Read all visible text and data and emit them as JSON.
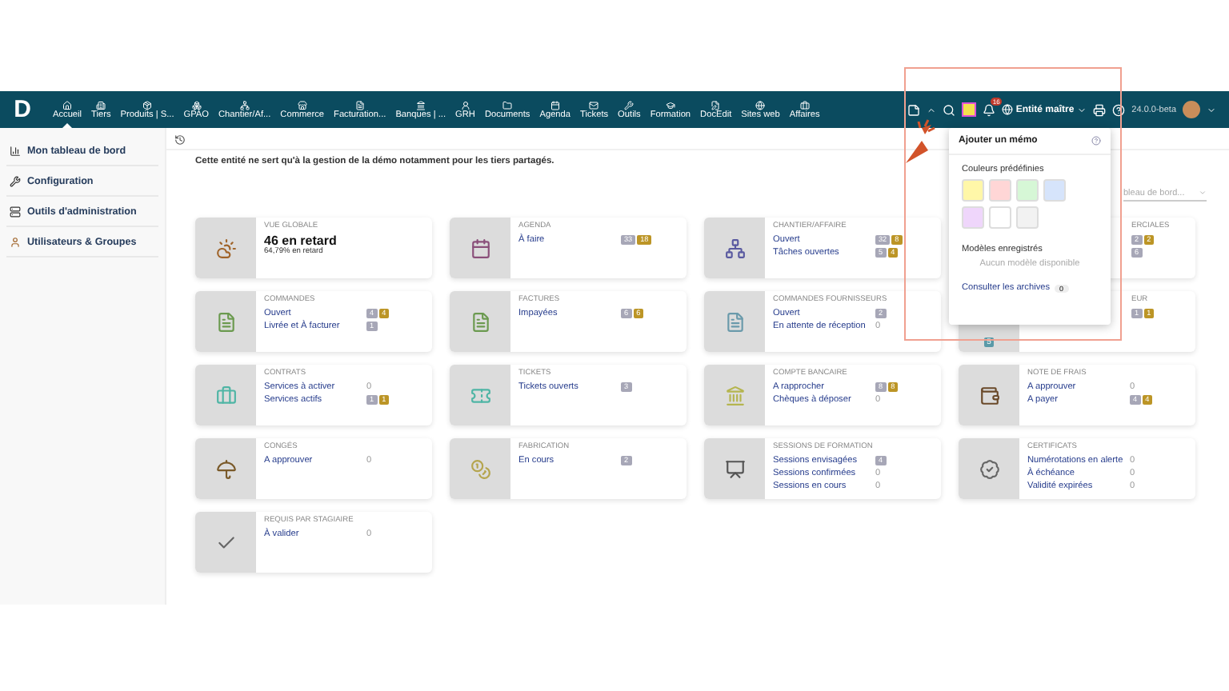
{
  "topbar": {
    "logo": "D",
    "menu": [
      {
        "label": "Accueil",
        "selected": true
      },
      {
        "label": "Tiers",
        "selected": false
      },
      {
        "label": "Produits | S...",
        "selected": false
      },
      {
        "label": "GPAO",
        "selected": false
      },
      {
        "label": "Chantier/Af...",
        "selected": false
      },
      {
        "label": "Commerce",
        "selected": false
      },
      {
        "label": "Facturation...",
        "selected": false
      },
      {
        "label": "Banques | ...",
        "selected": false
      },
      {
        "label": "GRH",
        "selected": false
      },
      {
        "label": "Documents",
        "selected": false
      },
      {
        "label": "Agenda",
        "selected": false
      },
      {
        "label": "Tickets",
        "selected": false
      },
      {
        "label": "Outils",
        "selected": false
      },
      {
        "label": "Formation",
        "selected": false
      },
      {
        "label": "DocEdit",
        "selected": false
      },
      {
        "label": "Sites web",
        "selected": false
      },
      {
        "label": "Affaires",
        "selected": false
      }
    ],
    "notification_count": "16",
    "entity": "Entité maître",
    "version": "24.0.0-beta"
  },
  "sidebar": {
    "items": [
      {
        "label": "Mon tableau de bord"
      },
      {
        "label": "Configuration"
      },
      {
        "label": "Outils d'administration"
      },
      {
        "label": "Utilisateurs & Groupes"
      }
    ]
  },
  "notice": "Cette entité ne sert qu'à la gestion de la démo notamment pour les tiers partagés.",
  "dashboard_select": "bleau de bord...",
  "cards": [
    {
      "kind": "summary",
      "title": "VUE GLOBALE",
      "headline": "46 en retard",
      "subline": "64,79% en retard"
    },
    {
      "kind": "list",
      "title": "AGENDA",
      "lines": [
        {
          "label": "À faire",
          "badges": [
            {
              "text": "33",
              "kind": "count"
            },
            {
              "text": "18",
              "kind": "late"
            }
          ]
        }
      ]
    },
    {
      "kind": "list",
      "title": "CHANTIER/AFFAIRE",
      "lines": [
        {
          "label": "Ouvert",
          "badges": [
            {
              "text": "32",
              "kind": "count"
            },
            {
              "text": "8",
              "kind": "late"
            }
          ]
        },
        {
          "label": "Tâches ouvertes",
          "badges": [
            {
              "text": "5",
              "kind": "count"
            },
            {
              "text": "4",
              "kind": "late"
            }
          ]
        }
      ]
    },
    {
      "kind": "list",
      "title": "ERCIALES",
      "covered": true,
      "lines": [
        {
          "badges": [
            {
              "text": "2",
              "kind": "count"
            },
            {
              "text": "2",
              "kind": "late"
            }
          ]
        },
        {
          "badges": [
            {
              "text": "6",
              "kind": "count"
            }
          ]
        }
      ]
    },
    {
      "kind": "list",
      "title": "COMMANDES",
      "lines": [
        {
          "label": "Ouvert",
          "badges": [
            {
              "text": "4",
              "kind": "count"
            },
            {
              "text": "4",
              "kind": "late"
            }
          ]
        },
        {
          "label": "Livrée et À facturer",
          "badges": [
            {
              "text": "1",
              "kind": "count"
            }
          ]
        }
      ]
    },
    {
      "kind": "list",
      "title": "FACTURES",
      "lines": [
        {
          "label": "Impayées",
          "badges": [
            {
              "text": "6",
              "kind": "count"
            },
            {
              "text": "6",
              "kind": "late"
            }
          ]
        }
      ]
    },
    {
      "kind": "list",
      "title": "COMMANDES FOURNISSEURS",
      "lines": [
        {
          "label": "Ouvert",
          "badges": [
            {
              "text": "2",
              "kind": "count"
            }
          ]
        },
        {
          "label": "En attente de réception",
          "value": "0"
        }
      ]
    },
    {
      "kind": "list",
      "title": "EUR",
      "covered": true,
      "icon_badge": "5",
      "lines": [
        {
          "badges": [
            {
              "text": "1",
              "kind": "count"
            },
            {
              "text": "1",
              "kind": "late"
            }
          ]
        }
      ]
    },
    {
      "kind": "list",
      "title": "CONTRATS",
      "lines": [
        {
          "label": "Services à activer",
          "value": "0"
        },
        {
          "label": "Services actifs",
          "badges": [
            {
              "text": "1",
              "kind": "count"
            },
            {
              "text": "1",
              "kind": "late"
            }
          ]
        }
      ]
    },
    {
      "kind": "list",
      "title": "TICKETS",
      "lines": [
        {
          "label": "Tickets ouverts",
          "badges": [
            {
              "text": "3",
              "kind": "count"
            }
          ]
        }
      ]
    },
    {
      "kind": "list",
      "title": "COMPTE BANCAIRE",
      "lines": [
        {
          "label": "A rapprocher",
          "badges": [
            {
              "text": "8",
              "kind": "count"
            },
            {
              "text": "8",
              "kind": "late"
            }
          ]
        },
        {
          "label": "Chèques à déposer",
          "value": "0"
        }
      ]
    },
    {
      "kind": "list",
      "title": "NOTE DE FRAIS",
      "lines": [
        {
          "label": "A approuver",
          "value": "0"
        },
        {
          "label": "A payer",
          "badges": [
            {
              "text": "4",
              "kind": "count"
            },
            {
              "text": "4",
              "kind": "late"
            }
          ]
        }
      ]
    },
    {
      "kind": "list",
      "title": "CONGÉS",
      "lines": [
        {
          "label": "A approuver",
          "value": "0"
        }
      ]
    },
    {
      "kind": "list",
      "title": "FABRICATION",
      "lines": [
        {
          "label": "En cours",
          "badges": [
            {
              "text": "2",
              "kind": "count"
            }
          ]
        }
      ]
    },
    {
      "kind": "list",
      "title": "SESSIONS DE FORMATION",
      "lines": [
        {
          "label": "Sessions envisagées",
          "badges": [
            {
              "text": "4",
              "kind": "count"
            }
          ]
        },
        {
          "label": "Sessions confirmées",
          "value": "0"
        },
        {
          "label": "Sessions en cours",
          "value": "0"
        }
      ]
    },
    {
      "kind": "list",
      "title": "CERTIFICATS",
      "lines": [
        {
          "label": "Numérotations en alerte",
          "value": "0"
        },
        {
          "label": "À échéance",
          "value": "0"
        },
        {
          "label": "Validité expirées",
          "value": "0"
        }
      ]
    },
    {
      "kind": "list",
      "title": "REQUIS PAR STAGIAIRE",
      "lines": [
        {
          "label": "À valider",
          "value": "0"
        }
      ]
    }
  ],
  "memo_popup": {
    "title": "Ajouter un mémo",
    "colors_label": "Couleurs prédéfinies",
    "colors": [
      {
        "color": "#fff7a8"
      },
      {
        "color": "#ffd6d6"
      },
      {
        "color": "#d6f7d6"
      },
      {
        "color": "#d6e4fb"
      },
      {
        "color": "#efd6fb"
      },
      {
        "color": "#ffffff"
      },
      {
        "color": "#f2f2f2"
      }
    ],
    "templates_label": "Modèles enregistrés",
    "empty_text": "Aucun modèle disponible",
    "archives_link": "Consulter les archives",
    "archives_count": "0"
  }
}
